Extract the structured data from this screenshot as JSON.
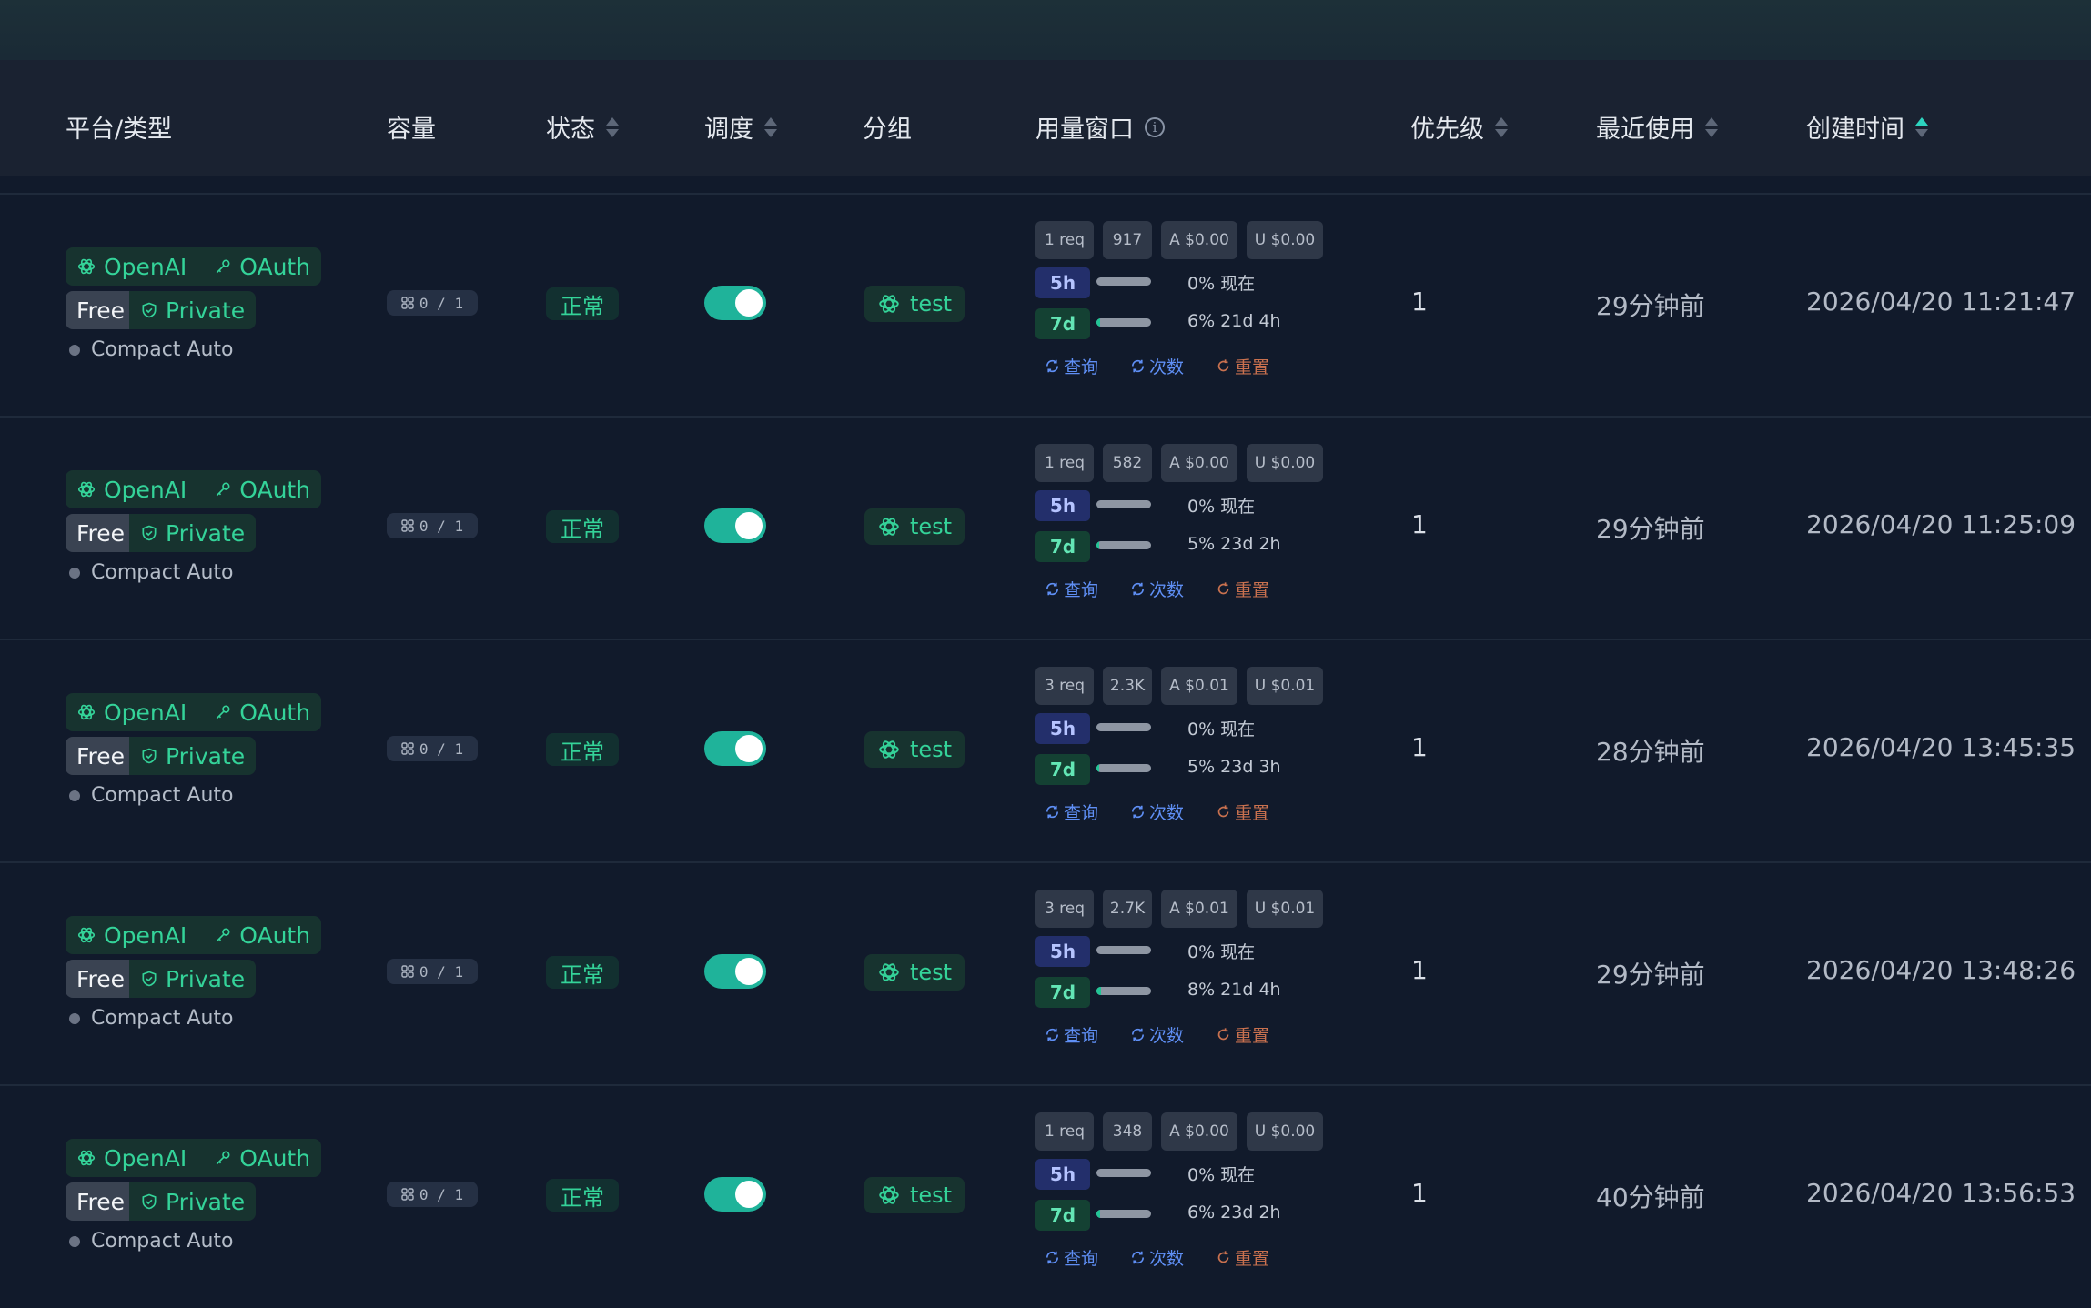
{
  "header": {
    "platform": "平台/类型",
    "capacity": "容量",
    "status": "状态",
    "schedule": "调度",
    "group": "分组",
    "usage_window": "用量窗口",
    "priority": "优先级",
    "last_used": "最近使用",
    "created_at": "创建时间"
  },
  "colors": {
    "accent": "#34d399",
    "toggle_on": "#1fb39a",
    "background": "#111a2b",
    "header_bg": "#1a2231",
    "link_blue": "#5f8ff5",
    "reset_orange": "#c9714f"
  },
  "rows": [
    {
      "platform": "OpenAI",
      "auth": "OAuth",
      "plan": "Free",
      "visibility": "Private",
      "mode": "Compact Auto",
      "capacity": "0 / 1",
      "status": "正常",
      "schedule_on": true,
      "group": "test",
      "reqs": "1 req",
      "tokens": "917",
      "a_cost": "A $0.00",
      "u_cost": "U $0.00",
      "w5h_label": "5h",
      "w5h_percent": 0,
      "w5h_text": "0% 现在",
      "w7d_label": "7d",
      "w7d_percent": 6,
      "w7d_text": "6% 21d 4h",
      "query": "查询",
      "count": "次数",
      "reset": "重置",
      "priority": "1",
      "last_used": "29分钟前",
      "created_at": "2026/04/20 11:21:47"
    },
    {
      "platform": "OpenAI",
      "auth": "OAuth",
      "plan": "Free",
      "visibility": "Private",
      "mode": "Compact Auto",
      "capacity": "0 / 1",
      "status": "正常",
      "schedule_on": true,
      "group": "test",
      "reqs": "1 req",
      "tokens": "582",
      "a_cost": "A $0.00",
      "u_cost": "U $0.00",
      "w5h_label": "5h",
      "w5h_percent": 0,
      "w5h_text": "0% 现在",
      "w7d_label": "7d",
      "w7d_percent": 5,
      "w7d_text": "5% 23d 2h",
      "query": "查询",
      "count": "次数",
      "reset": "重置",
      "priority": "1",
      "last_used": "29分钟前",
      "created_at": "2026/04/20 11:25:09"
    },
    {
      "platform": "OpenAI",
      "auth": "OAuth",
      "plan": "Free",
      "visibility": "Private",
      "mode": "Compact Auto",
      "capacity": "0 / 1",
      "status": "正常",
      "schedule_on": true,
      "group": "test",
      "reqs": "3 req",
      "tokens": "2.3K",
      "a_cost": "A $0.01",
      "u_cost": "U $0.01",
      "w5h_label": "5h",
      "w5h_percent": 0,
      "w5h_text": "0% 现在",
      "w7d_label": "7d",
      "w7d_percent": 5,
      "w7d_text": "5% 23d 3h",
      "query": "查询",
      "count": "次数",
      "reset": "重置",
      "priority": "1",
      "last_used": "28分钟前",
      "created_at": "2026/04/20 13:45:35"
    },
    {
      "platform": "OpenAI",
      "auth": "OAuth",
      "plan": "Free",
      "visibility": "Private",
      "mode": "Compact Auto",
      "capacity": "0 / 1",
      "status": "正常",
      "schedule_on": true,
      "group": "test",
      "reqs": "3 req",
      "tokens": "2.7K",
      "a_cost": "A $0.01",
      "u_cost": "U $0.01",
      "w5h_label": "5h",
      "w5h_percent": 0,
      "w5h_text": "0% 现在",
      "w7d_label": "7d",
      "w7d_percent": 8,
      "w7d_text": "8% 21d 4h",
      "query": "查询",
      "count": "次数",
      "reset": "重置",
      "priority": "1",
      "last_used": "29分钟前",
      "created_at": "2026/04/20 13:48:26"
    },
    {
      "platform": "OpenAI",
      "auth": "OAuth",
      "plan": "Free",
      "visibility": "Private",
      "mode": "Compact Auto",
      "capacity": "0 / 1",
      "status": "正常",
      "schedule_on": true,
      "group": "test",
      "reqs": "1 req",
      "tokens": "348",
      "a_cost": "A $0.00",
      "u_cost": "U $0.00",
      "w5h_label": "5h",
      "w5h_percent": 0,
      "w5h_text": "0% 现在",
      "w7d_label": "7d",
      "w7d_percent": 6,
      "w7d_text": "6% 23d 2h",
      "query": "查询",
      "count": "次数",
      "reset": "重置",
      "priority": "1",
      "last_used": "40分钟前",
      "created_at": "2026/04/20 13:56:53"
    }
  ]
}
